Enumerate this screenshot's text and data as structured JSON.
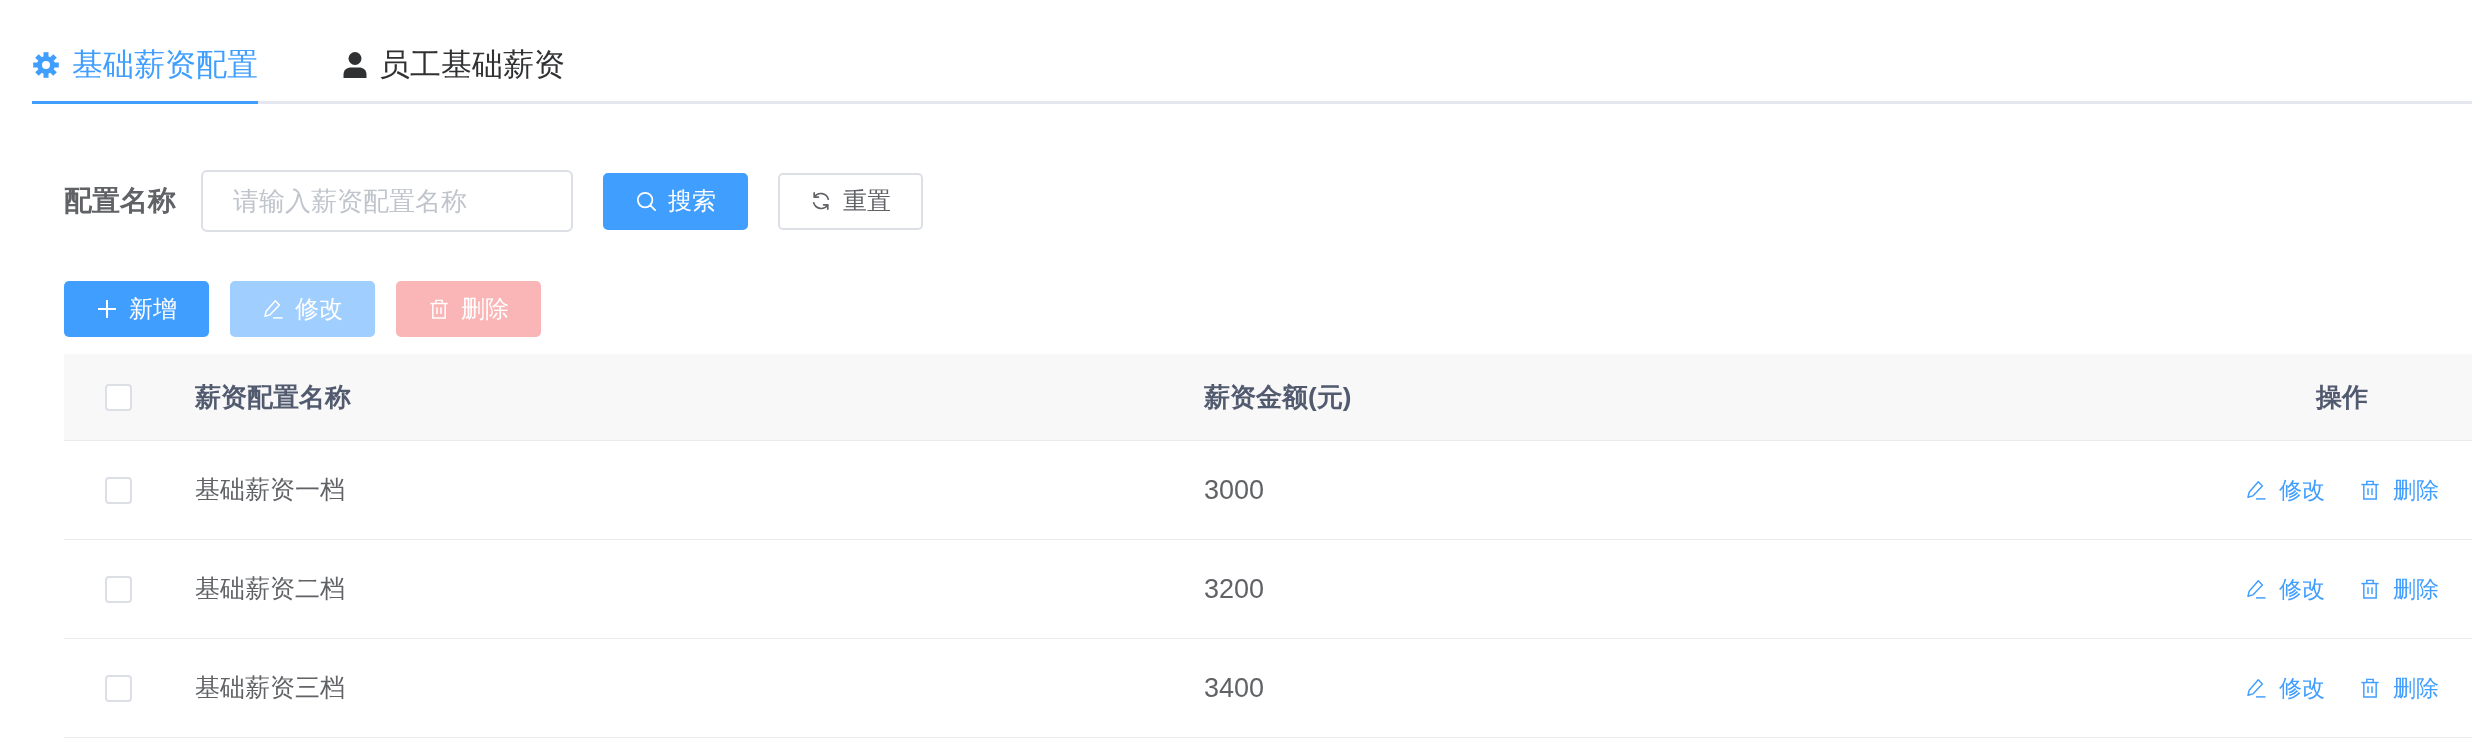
{
  "tabs": [
    {
      "label": "基础薪资配置",
      "kind": "config",
      "selected": true
    },
    {
      "label": "员工基础薪资",
      "kind": "staff",
      "selected": false
    }
  ],
  "search": {
    "label": "配置名称",
    "placeholder": "请输入薪资配置名称",
    "buttons": [
      {
        "label": "搜索",
        "kind": "search"
      },
      {
        "label": "重置",
        "kind": "reset"
      }
    ]
  },
  "toolbar": [
    {
      "label": "新增",
      "kind": "add",
      "disabled": false
    },
    {
      "label": "修改",
      "kind": "edit",
      "disabled": true
    },
    {
      "label": "删除",
      "kind": "delete",
      "disabled": true
    }
  ],
  "table": {
    "select_all": {
      "checked": false
    },
    "columns": [
      "薪资配置名称",
      "薪资金额(元)",
      "操作"
    ],
    "rows": [
      {
        "checked": false,
        "name": "基础薪资一档",
        "amount": "3000",
        "actions": [
          {
            "label": "修改",
            "kind": "edit"
          },
          {
            "label": "删除",
            "kind": "delete"
          }
        ]
      },
      {
        "checked": false,
        "name": "基础薪资二档",
        "amount": "3200",
        "actions": [
          {
            "label": "修改",
            "kind": "edit"
          },
          {
            "label": "删除",
            "kind": "delete"
          }
        ]
      },
      {
        "checked": false,
        "name": "基础薪资三档",
        "amount": "3400",
        "actions": [
          {
            "label": "修改",
            "kind": "edit"
          },
          {
            "label": "删除",
            "kind": "delete"
          }
        ]
      }
    ]
  }
}
